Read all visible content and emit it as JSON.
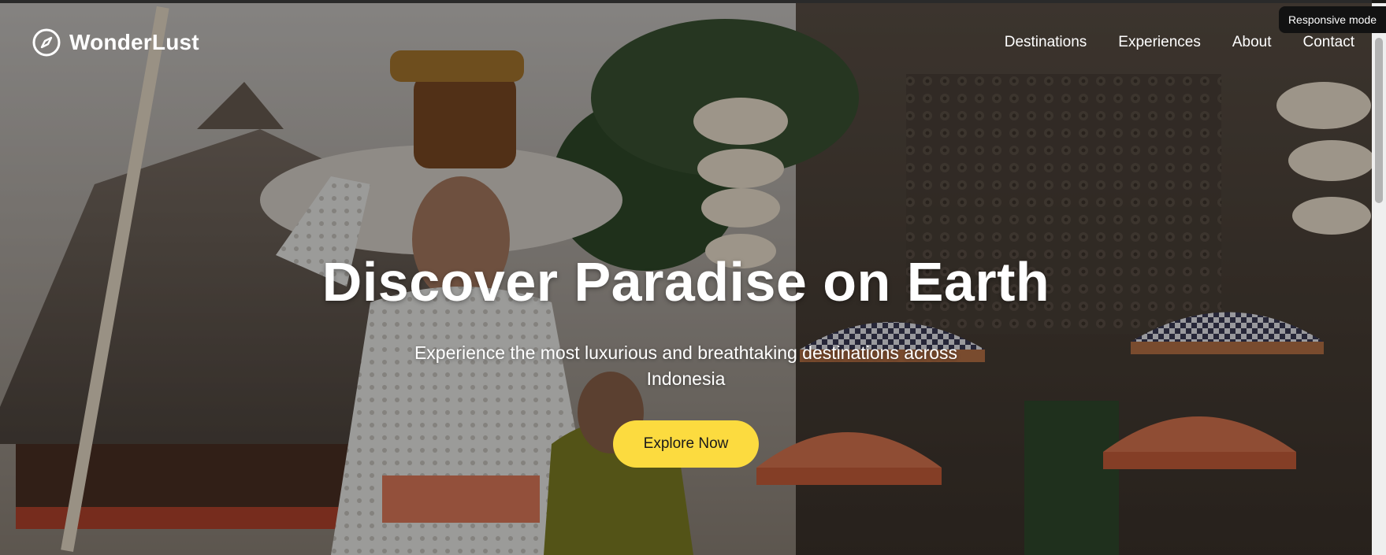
{
  "brand": {
    "name": "WonderLust",
    "icon": "compass-icon"
  },
  "nav": {
    "items": [
      "Destinations",
      "Experiences",
      "About",
      "Contact"
    ]
  },
  "hero": {
    "title": "Discover Paradise on Earth",
    "subtitle": "Experience the most luxurious and breathtaking destinations across Indonesia",
    "cta_label": "Explore Now",
    "background": "balinese-temple-photo"
  },
  "badge": {
    "label": "Responsive mode"
  },
  "colors": {
    "accent": "#fcdb3f",
    "text": "#ffffff"
  }
}
